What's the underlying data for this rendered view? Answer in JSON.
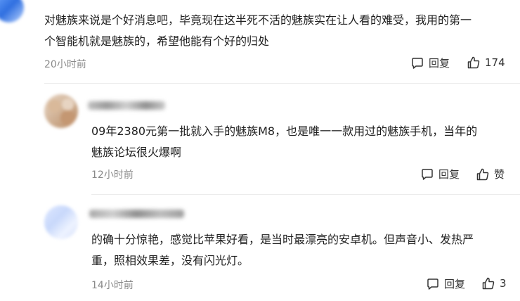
{
  "comments": [
    {
      "text_line1": "对魅族来说是个好消息吧，毕竟现在这半死不活的魅族实在让人看的难受，我用的第一",
      "text_line2": "个智能机就是魅族的，希望他能有个好的归处",
      "time": "20小时前",
      "reply_label": "回复",
      "like_label": "174"
    },
    {
      "text_line1": "09年2380元第一批就入手的魅族M8，也是唯一一款用过的魅族手机，当年的",
      "text_line2": "魅族论坛很火爆啊",
      "time": "12小时前",
      "reply_label": "回复",
      "like_label": "赞"
    },
    {
      "text_line1": "的确十分惊艳，感觉比苹果好看，是当时最漂亮的安卓机。但声音小、发热严",
      "text_line2": "重，照相效果差，没有闪光灯。",
      "time": "14小时前",
      "reply_label": "回复",
      "like_label": "3"
    }
  ],
  "colors": {
    "text": "#1f1f1f",
    "meta": "#8a8a8a",
    "divider": "#ececec"
  },
  "icons": [
    "comment-bubble-icon",
    "thumbs-up-icon"
  ]
}
